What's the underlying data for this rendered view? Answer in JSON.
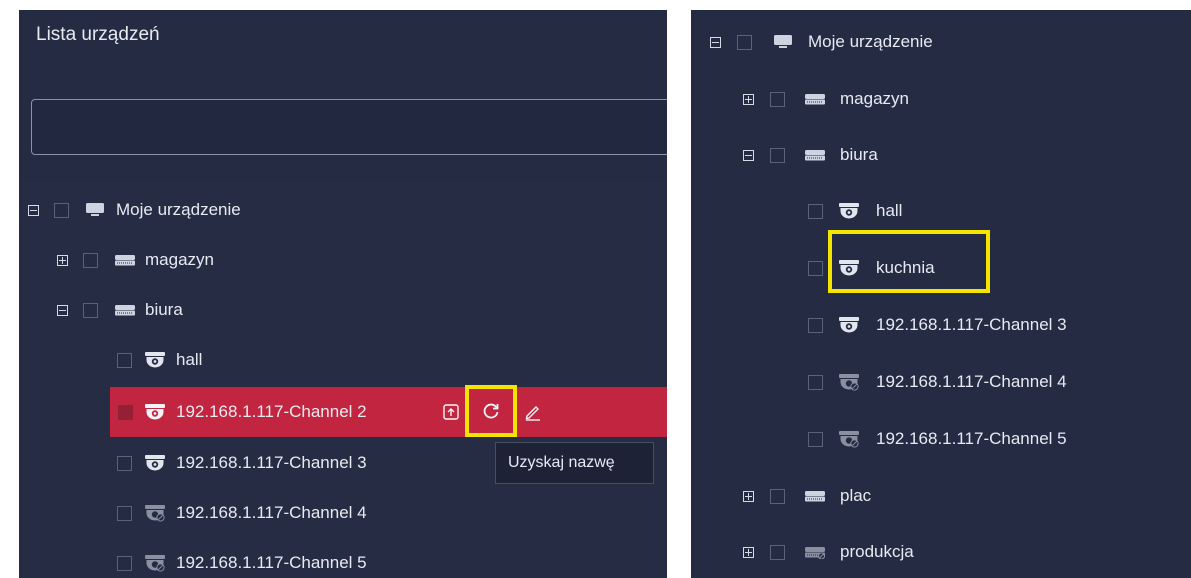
{
  "left_panel": {
    "title": "Lista urządzeń",
    "search": {
      "value": ""
    },
    "tree": {
      "root": "Moje urządzenie",
      "groups": [
        {
          "label": "magazyn",
          "state": "collapsed"
        },
        {
          "label": "biura",
          "state": "expanded"
        }
      ],
      "channels": [
        {
          "label": "hall",
          "status": "online"
        },
        {
          "label": "192.168.1.117-Channel 2",
          "status": "online",
          "selected": true
        },
        {
          "label": "192.168.1.117-Channel 3",
          "status": "online"
        },
        {
          "label": "192.168.1.117-Channel 4",
          "status": "offline"
        },
        {
          "label": "192.168.1.117-Channel 5",
          "status": "offline"
        }
      ]
    },
    "row_actions": [
      "upload-icon",
      "refresh-icon",
      "edit-icon"
    ],
    "tooltip": "Uzyskaj nazwę"
  },
  "right_panel": {
    "tree": {
      "root": "Moje urządzenie",
      "groups_top": [
        {
          "label": "magazyn",
          "state": "collapsed"
        },
        {
          "label": "biura",
          "state": "expanded"
        }
      ],
      "channels": [
        {
          "label": "hall",
          "status": "online"
        },
        {
          "label": "kuchnia",
          "status": "online",
          "highlighted": true
        },
        {
          "label": "192.168.1.117-Channel 3",
          "status": "online"
        },
        {
          "label": "192.168.1.117-Channel 4",
          "status": "offline"
        },
        {
          "label": "192.168.1.117-Channel 5",
          "status": "offline"
        }
      ],
      "groups_bottom": [
        {
          "label": "plac",
          "state": "collapsed"
        },
        {
          "label": "produkcja",
          "state": "collapsed",
          "status": "offline"
        }
      ]
    }
  },
  "colors": {
    "panel_bg": "#252b43",
    "selected_row": "#c2253f",
    "highlight": "#f5e400"
  }
}
